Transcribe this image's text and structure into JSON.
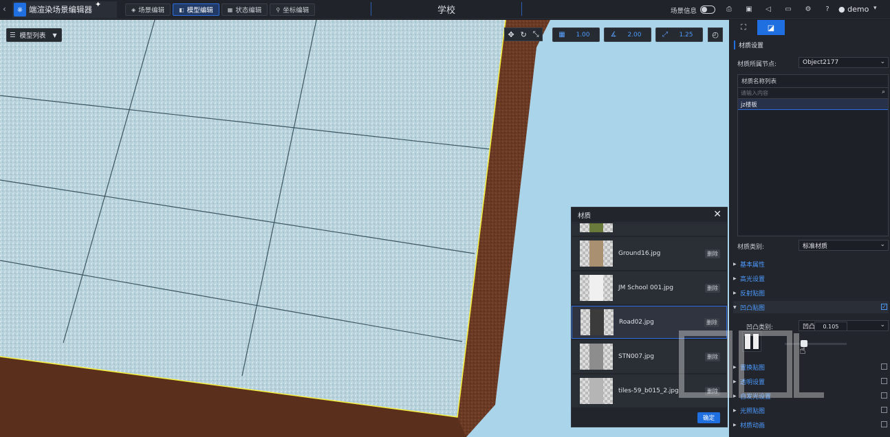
{
  "app": {
    "name": "端渲染场景编辑器",
    "scene_title": "学校",
    "modes": [
      {
        "label": "场景编辑",
        "icon": "layers-icon",
        "active": false
      },
      {
        "label": "模型编辑",
        "icon": "cube-icon",
        "active": true
      },
      {
        "label": "状态编辑",
        "icon": "grid-icon",
        "active": false
      },
      {
        "label": "坐标编辑",
        "icon": "pin-icon",
        "active": false
      }
    ],
    "scene_info_label": "场景信息",
    "user_name": "demo",
    "accent": "#1f6fe0"
  },
  "viewport": {
    "model_list_label": "模型列表",
    "snap_move": "1.00",
    "snap_rotate": "2.00",
    "snap_scale": "1.25",
    "sky_color": "#a9d4ea",
    "selection_color": "#f5ee3a"
  },
  "material_dialog": {
    "title": "材质",
    "items": [
      {
        "name": "Ground16.jpg",
        "delete": "删除",
        "selected": false
      },
      {
        "name": "JM School 001.jpg",
        "delete": "删除",
        "selected": false
      },
      {
        "name": "Road02.jpg",
        "delete": "删除",
        "selected": true
      },
      {
        "name": "STN007.jpg",
        "delete": "删除",
        "selected": false
      },
      {
        "name": "tiles-59_b015_2.jpg",
        "delete": "删除",
        "selected": false
      }
    ],
    "ok_label": "确定"
  },
  "right_panel": {
    "section_title": "材质设置",
    "node_label": "材质所属节点:",
    "node_value": "Object2177",
    "name_list_title": "材质名称列表",
    "search_placeholder": "请输入内容",
    "selected_name": "jz楼板",
    "type_label": "材质类别:",
    "type_value": "标准材质",
    "groups": [
      {
        "label": "基本属性",
        "has_check": false
      },
      {
        "label": "高光设置",
        "has_check": false
      },
      {
        "label": "反射贴图",
        "has_check": false
      },
      {
        "label": "凹凸贴图",
        "has_check": true,
        "checked": true,
        "open": true
      },
      {
        "label": "置换贴图",
        "has_check": true,
        "checked": false
      },
      {
        "label": "透明设置",
        "has_check": true,
        "checked": false
      },
      {
        "label": "自发光设置",
        "has_check": true,
        "checked": false
      },
      {
        "label": "光照贴图",
        "has_check": true,
        "checked": false
      },
      {
        "label": "材质动画",
        "has_check": true,
        "checked": false
      }
    ],
    "bump_type_label": "凹凸类别:",
    "bump_type_value": "凹凸贴图",
    "bump_value": "0.105",
    "bump_level": 0.25
  }
}
